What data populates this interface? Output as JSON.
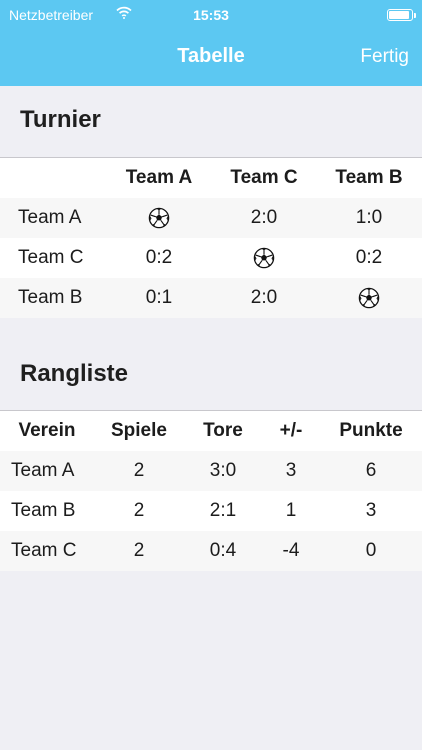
{
  "status_bar": {
    "carrier": "Netzbetreiber",
    "time": "15:53",
    "battery_level": 0.92,
    "icons": [
      "wifi-icon",
      "battery-icon"
    ]
  },
  "nav": {
    "title": "Tabelle",
    "done_label": "Fertig"
  },
  "tournament": {
    "title": "Turnier",
    "columns": [
      "Team A",
      "Team C",
      "Team B"
    ],
    "rows": [
      {
        "team": "Team A",
        "cells": [
          "soccer-ball-icon",
          "2:0",
          "1:0"
        ]
      },
      {
        "team": "Team C",
        "cells": [
          "0:2",
          "soccer-ball-icon",
          "0:2"
        ]
      },
      {
        "team": "Team B",
        "cells": [
          "0:1",
          "2:0",
          "soccer-ball-icon"
        ]
      }
    ]
  },
  "ranking": {
    "title": "Rangliste",
    "columns": [
      "Verein",
      "Spiele",
      "Tore",
      "+/-",
      "Punkte"
    ],
    "rows": [
      [
        "Team A",
        "2",
        "3:0",
        "3",
        "6"
      ],
      [
        "Team B",
        "2",
        "2:1",
        "1",
        "3"
      ],
      [
        "Team C",
        "2",
        "0:4",
        "-4",
        "0"
      ]
    ]
  },
  "colors": {
    "nav_background": "#5cc8f2",
    "page_background": "#efeff4",
    "table_background": "#ffffff",
    "alt_row": "#f7f7f7"
  }
}
